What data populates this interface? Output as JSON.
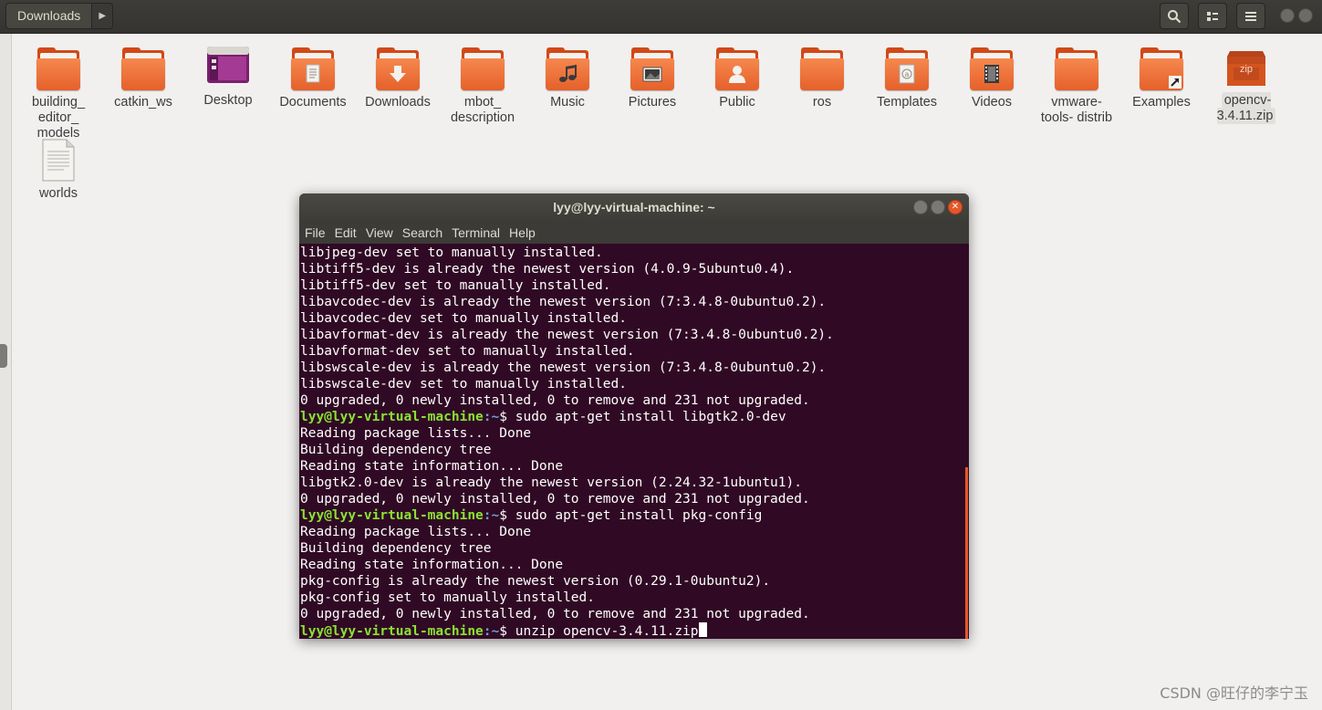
{
  "header": {
    "location": "Downloads",
    "next_icon": "triangle-right-icon",
    "buttons": [
      "search-icon",
      "view-options-icon",
      "hamburger-menu-icon"
    ]
  },
  "files": [
    {
      "label": "building_ editor_ models",
      "type": "folder"
    },
    {
      "label": "catkin_ws",
      "type": "folder"
    },
    {
      "label": "Desktop",
      "type": "desktop"
    },
    {
      "label": "Documents",
      "type": "folder",
      "emblem": "document-icon"
    },
    {
      "label": "Downloads",
      "type": "folder",
      "emblem": "download-arrow-icon"
    },
    {
      "label": "mbot_ description",
      "type": "folder"
    },
    {
      "label": "Music",
      "type": "folder",
      "emblem": "music-note-icon"
    },
    {
      "label": "Pictures",
      "type": "folder",
      "emblem": "picture-icon"
    },
    {
      "label": "Public",
      "type": "folder",
      "emblem": "person-icon"
    },
    {
      "label": "ros",
      "type": "folder"
    },
    {
      "label": "Templates",
      "type": "folder",
      "emblem": "template-icon"
    },
    {
      "label": "Videos",
      "type": "folder",
      "emblem": "film-icon"
    },
    {
      "label": "vmware- tools- distrib",
      "type": "folder"
    },
    {
      "label": "Examples",
      "type": "folder",
      "emblem": "symlink-arrow-icon"
    },
    {
      "label": "opencv- 3.4.11.zip",
      "type": "zip",
      "badge": "zip"
    },
    {
      "label": "worlds",
      "type": "file"
    }
  ],
  "terminal": {
    "title": "lyy@lyy-virtual-machine: ~",
    "menu": [
      "File",
      "Edit",
      "View",
      "Search",
      "Terminal",
      "Help"
    ],
    "prompt_user": "lyy@lyy-virtual-machine",
    "prompt_path": ":~",
    "prompt_sign": "$ ",
    "lines": [
      {
        "text": "libjpeg-dev set to manually installed."
      },
      {
        "text": "libtiff5-dev is already the newest version (4.0.9-5ubuntu0.4)."
      },
      {
        "text": "libtiff5-dev set to manually installed."
      },
      {
        "text": "libavcodec-dev is already the newest version (7:3.4.8-0ubuntu0.2)."
      },
      {
        "text": "libavcodec-dev set to manually installed."
      },
      {
        "text": "libavformat-dev is already the newest version (7:3.4.8-0ubuntu0.2)."
      },
      {
        "text": "libavformat-dev set to manually installed."
      },
      {
        "text": "libswscale-dev is already the newest version (7:3.4.8-0ubuntu0.2)."
      },
      {
        "text": "libswscale-dev set to manually installed."
      },
      {
        "text": "0 upgraded, 0 newly installed, 0 to remove and 231 not upgraded."
      },
      {
        "prompt": true,
        "text": "sudo apt-get install libgtk2.0-dev"
      },
      {
        "text": "Reading package lists... Done"
      },
      {
        "text": "Building dependency tree"
      },
      {
        "text": "Reading state information... Done"
      },
      {
        "text": "libgtk2.0-dev is already the newest version (2.24.32-1ubuntu1)."
      },
      {
        "text": "0 upgraded, 0 newly installed, 0 to remove and 231 not upgraded."
      },
      {
        "prompt": true,
        "text": "sudo apt-get install pkg-config"
      },
      {
        "text": "Reading package lists... Done"
      },
      {
        "text": "Building dependency tree"
      },
      {
        "text": "Reading state information... Done"
      },
      {
        "text": "pkg-config is already the newest version (0.29.1-0ubuntu2)."
      },
      {
        "text": "pkg-config set to manually installed."
      },
      {
        "text": "0 upgraded, 0 newly installed, 0 to remove and 231 not upgraded."
      },
      {
        "prompt": true,
        "text": "unzip opencv-3.4.11.zip",
        "cursor": true
      }
    ]
  },
  "watermark": "CSDN @旺仔的李宁玉",
  "colors": {
    "folder_orange": "#e5602a",
    "terminal_bg": "#300a24",
    "prompt_user": "#8ae234",
    "prompt_path": "#729fcf",
    "scrollbar": "#e8562a"
  }
}
